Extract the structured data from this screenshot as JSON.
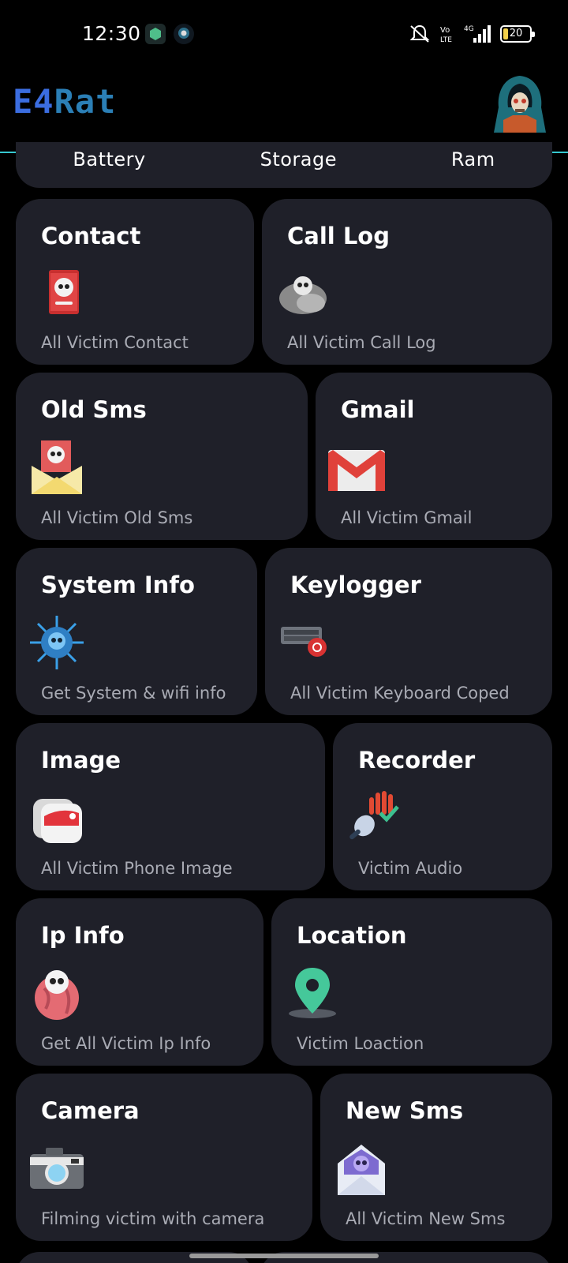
{
  "status_bar": {
    "time": "12:30",
    "battery_level": "20",
    "network": "4G"
  },
  "header": {
    "logo_part1": "E4",
    "logo_part2": "Rat",
    "accent_color": "#36c8d0"
  },
  "stats": {
    "battery_label": "Battery",
    "storage_label": "Storage",
    "ram_label": "Ram"
  },
  "cards": [
    {
      "title": "Contact",
      "subtitle": "All Victim Contact",
      "icon": "skull-book-icon"
    },
    {
      "title": "Call Log",
      "subtitle": "All Victim Call Log",
      "icon": "skull-cloud-icon"
    },
    {
      "title": "Old Sms",
      "subtitle": "All Victim Old Sms",
      "icon": "skull-envelope-icon"
    },
    {
      "title": "Gmail",
      "subtitle": "All Victim Gmail",
      "icon": "gmail-icon"
    },
    {
      "title": "System Info",
      "subtitle": "Get System & wifi info",
      "icon": "virus-skull-icon"
    },
    {
      "title": "Keylogger",
      "subtitle": "All Victim Keyboard Coped",
      "icon": "keyboard-biohazard-icon"
    },
    {
      "title": "Image",
      "subtitle": "All Victim Phone Image",
      "icon": "photos-icon"
    },
    {
      "title": "Recorder",
      "subtitle": "Victim Audio",
      "icon": "microphone-icon"
    },
    {
      "title": "Ip Info",
      "subtitle": "Get All Victim Ip Info",
      "icon": "skull-globe-icon"
    },
    {
      "title": "Location",
      "subtitle": "Victim Loaction",
      "icon": "location-pin-icon"
    },
    {
      "title": "Camera",
      "subtitle": "Filming victim with camera",
      "icon": "camera-icon"
    },
    {
      "title": "New Sms",
      "subtitle": "All Victim New Sms",
      "icon": "skull-mail-icon"
    }
  ]
}
